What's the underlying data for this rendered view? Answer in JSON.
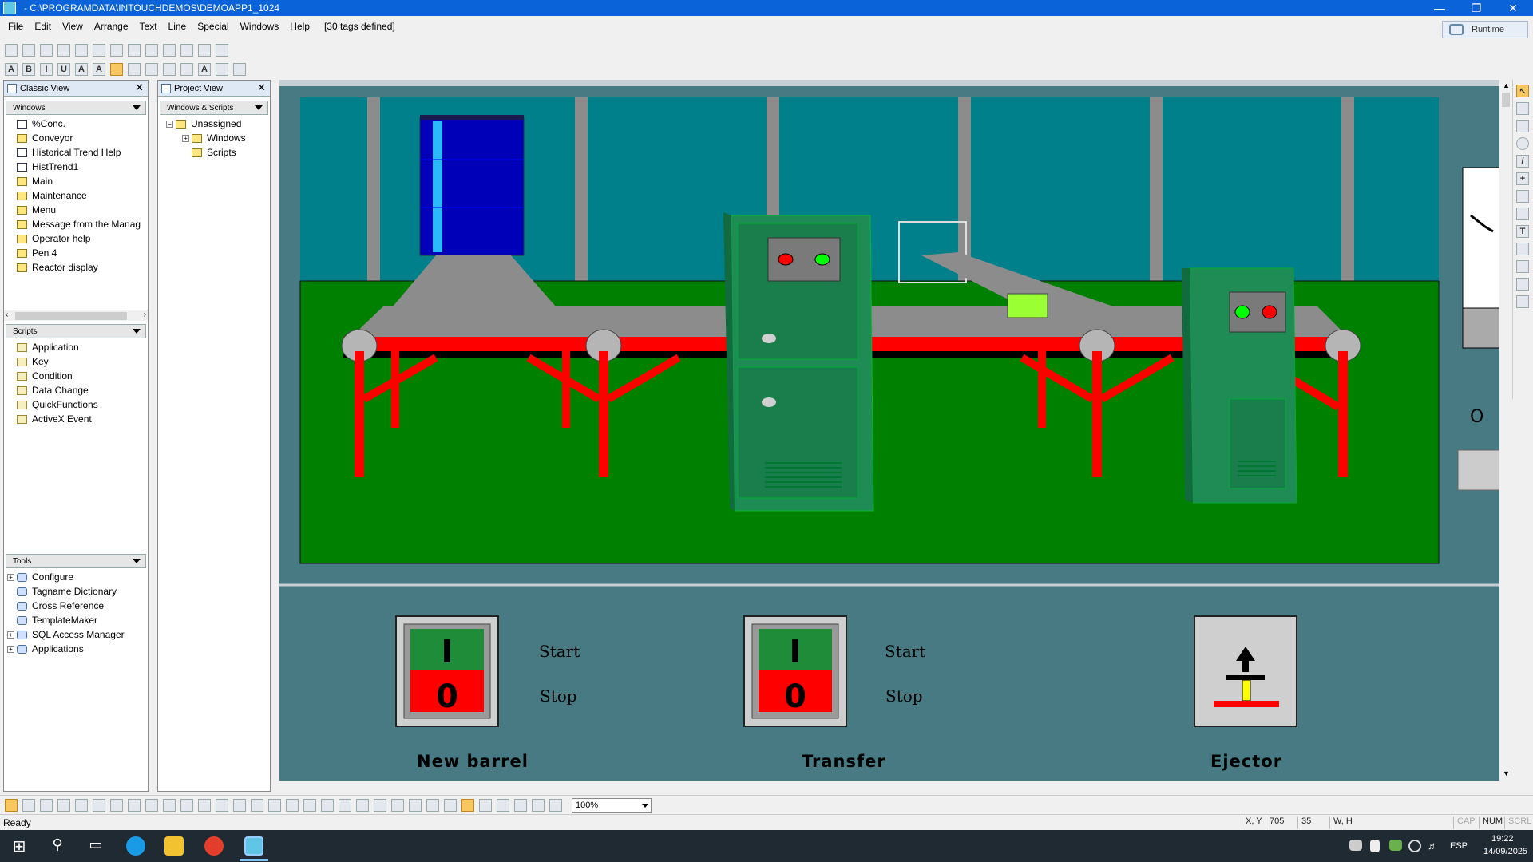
{
  "window": {
    "title": "- C:\\PROGRAMDATA\\INTOUCHDEMOS\\DEMOAPP1_1024",
    "minimize_icon": "minimize-icon",
    "restore_icon": "restore-icon",
    "close_icon": "close-icon"
  },
  "menu": {
    "items": [
      "File",
      "Edit",
      "View",
      "Arrange",
      "Text",
      "Line",
      "Special",
      "Windows",
      "Help"
    ],
    "tags_info": "[30 tags defined]",
    "runtime_label": "Runtime"
  },
  "classic_view": {
    "title": "Classic View",
    "windows_section": "Windows",
    "windows": [
      "%Conc.",
      "Conveyor",
      "Historical Trend Help",
      "HistTrend1",
      "Main",
      "Maintenance",
      "Menu",
      "Message from the Manag",
      "Operator help",
      "Pen 4",
      "Reactor display"
    ],
    "scripts_section": "Scripts",
    "scripts": [
      "Application",
      "Key",
      "Condition",
      "Data Change",
      "QuickFunctions",
      "ActiveX Event"
    ],
    "tools_section": "Tools",
    "tools": [
      "Configure",
      "Tagname Dictionary",
      "Cross Reference",
      "TemplateMaker",
      "SQL Access Manager",
      "Applications"
    ]
  },
  "project_view": {
    "title": "Project View",
    "section": "Windows & Scripts",
    "tree": [
      "Unassigned",
      "Windows",
      "Scripts"
    ]
  },
  "canvas": {
    "controls": [
      {
        "name": "New barrel",
        "on_glyph": "I",
        "off_glyph": "0",
        "start": "Start",
        "stop": "Stop"
      },
      {
        "name": "Transfer",
        "on_glyph": "I",
        "off_glyph": "0",
        "start": "Start",
        "stop": "Stop"
      },
      {
        "name": "Ejector"
      }
    ],
    "side_label": "O"
  },
  "bottom_toolbar": {
    "zoom": "100%"
  },
  "status": {
    "text": "Ready",
    "xy_label": "X, Y",
    "x": "705",
    "y": "35",
    "wh_label": "W, H",
    "cap": "CAP",
    "num": "NUM",
    "scrl": "SCRL"
  },
  "taskbar": {
    "lang": "ESP",
    "time": "19:22",
    "date": "14/09/2025"
  },
  "colors": {
    "titlebar": "#0a63d8",
    "canvas_bg": "#477a82",
    "floor": "#008000",
    "wall": "#00808a",
    "frame_red": "#ff0000",
    "machine_green": "#1f8c55"
  }
}
